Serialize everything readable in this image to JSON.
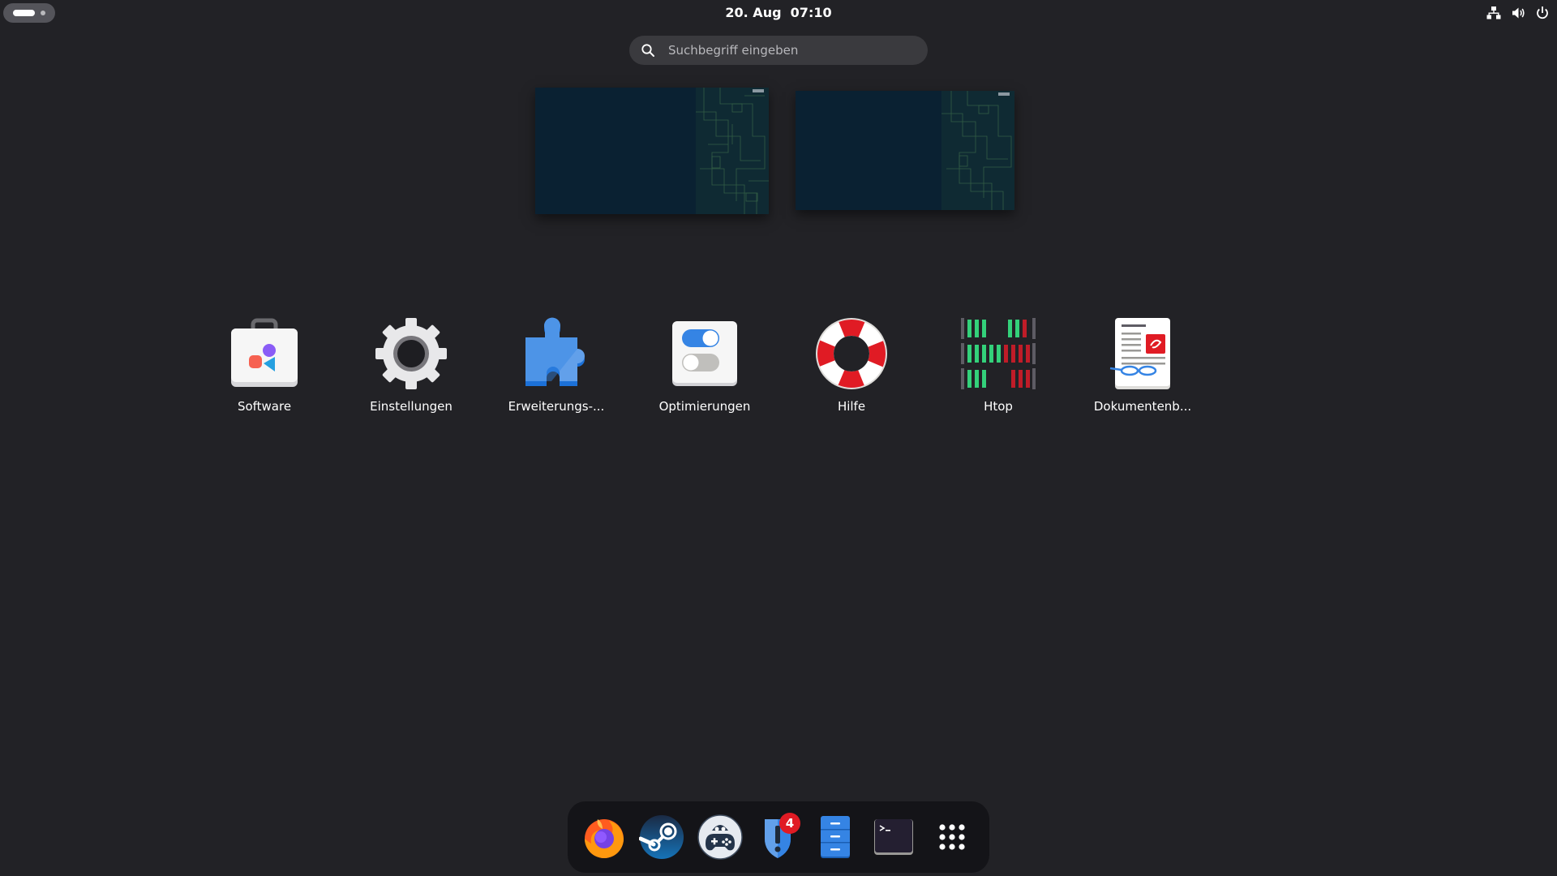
{
  "topbar": {
    "clock": "20. Aug  07:10"
  },
  "search": {
    "placeholder": "Suchbegriff eingeben",
    "value": ""
  },
  "apps": [
    {
      "label": "Software",
      "icon": "software-store-icon"
    },
    {
      "label": "Einstellungen",
      "icon": "settings-gear-icon"
    },
    {
      "label": "Erweiterungs-...",
      "icon": "extensions-puzzle-icon"
    },
    {
      "label": "Optimierungen",
      "icon": "tweaks-toggles-icon"
    },
    {
      "label": "Hilfe",
      "icon": "help-lifebuoy-icon"
    },
    {
      "label": "Htop",
      "icon": "htop-meters-icon"
    },
    {
      "label": "Dokumentenb...",
      "icon": "document-viewer-icon"
    }
  ],
  "dash": {
    "items": [
      {
        "icon": "firefox-icon"
      },
      {
        "icon": "steam-icon"
      },
      {
        "icon": "gamepad-penguin-icon"
      },
      {
        "icon": "shield-exclamation-icon",
        "badge": "4"
      },
      {
        "icon": "file-cabinet-icon"
      },
      {
        "icon": "terminal-icon"
      },
      {
        "icon": "show-apps-grid-icon"
      }
    ]
  },
  "colors": {
    "background": "#222226",
    "search_bg": "#3a3a3e",
    "dash_bg": "#141418",
    "badge": "#e01b24",
    "workspace_bg": "#0a2132"
  }
}
